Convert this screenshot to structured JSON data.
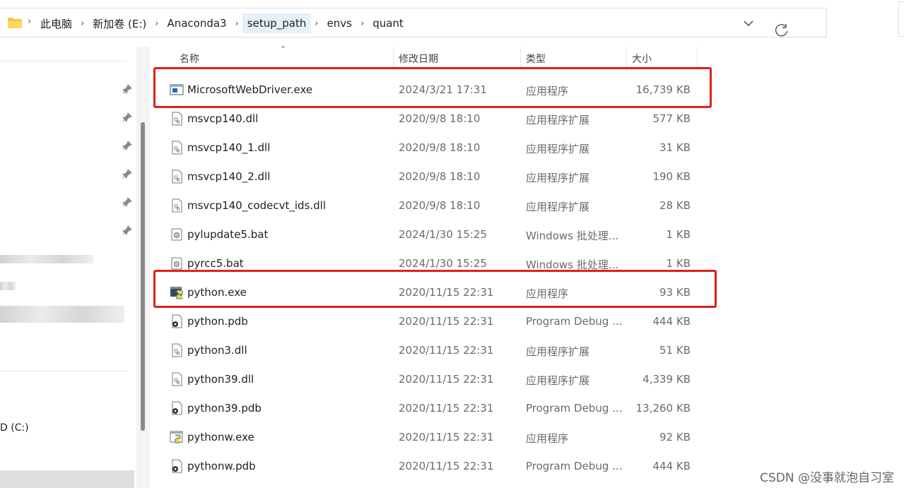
{
  "address_bar": {
    "breadcrumbs": [
      "此电脑",
      "新加卷 (E:)",
      "Anaconda3",
      "setup_path",
      "envs",
      "quant"
    ],
    "active_crumb": "setup_path"
  },
  "nav_pane": {
    "drive_label": "D (C:)"
  },
  "columns": {
    "name": "名称",
    "date": "修改日期",
    "type": "类型",
    "size": "大小"
  },
  "files": [
    {
      "name": "MicrosoftWebDriver.exe",
      "date": "2024/3/21 17:31",
      "type": "应用程序",
      "size": "16,739 KB",
      "icon": "app-exe-icon",
      "highlighted": true
    },
    {
      "name": "msvcp140.dll",
      "date": "2020/9/8 18:10",
      "type": "应用程序扩展",
      "size": "577 KB",
      "icon": "dll-file-icon",
      "highlighted": false
    },
    {
      "name": "msvcp140_1.dll",
      "date": "2020/9/8 18:10",
      "type": "应用程序扩展",
      "size": "31 KB",
      "icon": "dll-file-icon",
      "highlighted": false
    },
    {
      "name": "msvcp140_2.dll",
      "date": "2020/9/8 18:10",
      "type": "应用程序扩展",
      "size": "190 KB",
      "icon": "dll-file-icon",
      "highlighted": false
    },
    {
      "name": "msvcp140_codecvt_ids.dll",
      "date": "2020/9/8 18:10",
      "type": "应用程序扩展",
      "size": "28 KB",
      "icon": "dll-file-icon",
      "highlighted": false
    },
    {
      "name": "pylupdate5.bat",
      "date": "2024/1/30 15:25",
      "type": "Windows 批处理...",
      "size": "1 KB",
      "icon": "bat-file-icon",
      "highlighted": false
    },
    {
      "name": "pyrcc5.bat",
      "date": "2024/1/30 15:25",
      "type": "Windows 批处理...",
      "size": "1 KB",
      "icon": "bat-file-icon",
      "highlighted": false
    },
    {
      "name": "python.exe",
      "date": "2020/11/15 22:31",
      "type": "应用程序",
      "size": "93 KB",
      "icon": "python-exe-icon",
      "highlighted": true
    },
    {
      "name": "python.pdb",
      "date": "2020/11/15 22:31",
      "type": "Program Debug ...",
      "size": "444 KB",
      "icon": "pdb-file-icon",
      "highlighted": false
    },
    {
      "name": "python3.dll",
      "date": "2020/11/15 22:31",
      "type": "应用程序扩展",
      "size": "51 KB",
      "icon": "dll-file-icon",
      "highlighted": false
    },
    {
      "name": "python39.dll",
      "date": "2020/11/15 22:31",
      "type": "应用程序扩展",
      "size": "4,339 KB",
      "icon": "dll-file-icon",
      "highlighted": false
    },
    {
      "name": "python39.pdb",
      "date": "2020/11/15 22:31",
      "type": "Program Debug ...",
      "size": "13,260 KB",
      "icon": "pdb-file-icon",
      "highlighted": false
    },
    {
      "name": "pythonw.exe",
      "date": "2020/11/15 22:31",
      "type": "应用程序",
      "size": "92 KB",
      "icon": "pythonw-exe-icon",
      "highlighted": false
    },
    {
      "name": "pythonw.pdb",
      "date": "2020/11/15 22:31",
      "type": "Program Debug ...",
      "size": "444 KB",
      "icon": "pdb-file-icon",
      "highlighted": false
    }
  ],
  "colors": {
    "highlight_box": "#e0201c",
    "folder_yellow": "#f5c244",
    "active_crumb_bg": "#e5f0fb"
  },
  "watermark": "CSDN @没事就泡自习室"
}
